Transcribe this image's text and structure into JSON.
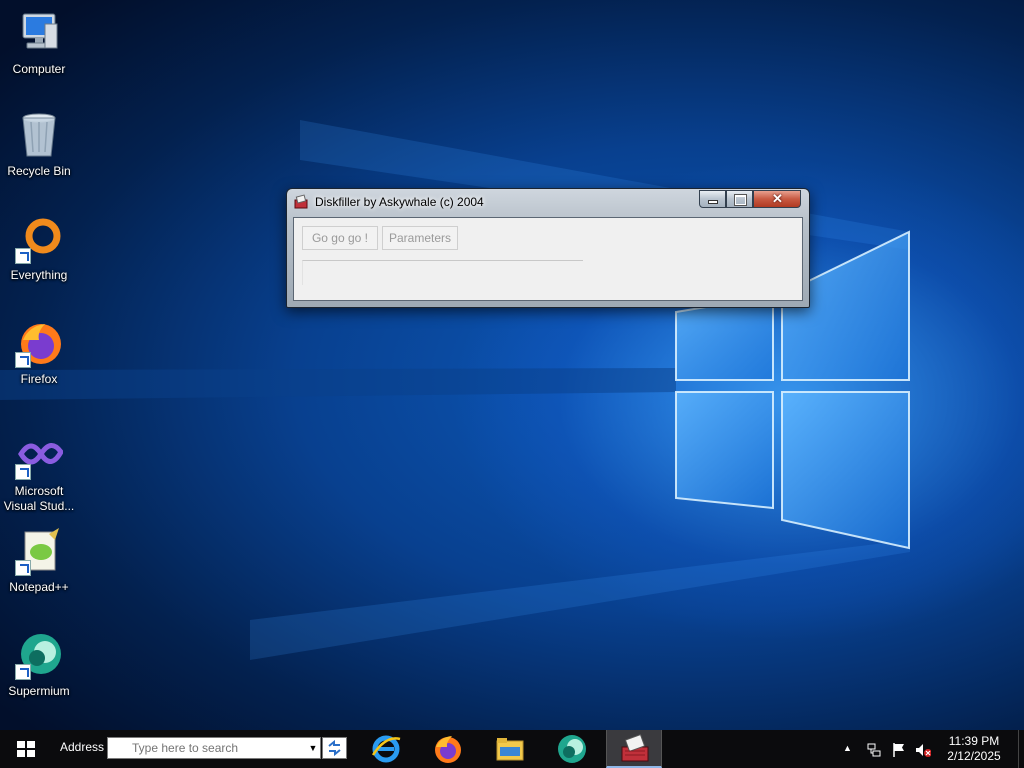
{
  "desktop": {
    "icons": [
      {
        "label": "Computer",
        "icon": "computer-icon"
      },
      {
        "label": "Recycle Bin",
        "icon": "recycle-bin-icon"
      },
      {
        "label": "Everything",
        "icon": "everything-icon"
      },
      {
        "label": "Firefox",
        "icon": "firefox-icon"
      },
      {
        "label": "Microsoft Visual Stud...",
        "icon": "visual-studio-icon"
      },
      {
        "label": "Notepad++",
        "icon": "notepadpp-icon"
      },
      {
        "label": "Supermium",
        "icon": "supermium-icon"
      }
    ]
  },
  "window": {
    "title": "Diskfiller by Askywhale (c) 2004",
    "icon": "diskfiller-app-icon",
    "buttons": {
      "go": "Go go go !",
      "parameters": "Parameters"
    },
    "controls": [
      "minimize-icon",
      "maximize-icon",
      "close-icon"
    ]
  },
  "taskbar": {
    "address_label": "Address",
    "search_placeholder": "Type here to search",
    "pinned": [
      "internet-explorer-icon",
      "firefox-icon",
      "file-explorer-icon",
      "supermium-icon",
      "diskfiller-icon"
    ],
    "clock": {
      "time": "11:39 PM",
      "date": "2/12/2025"
    }
  },
  "colors": {
    "taskbar": "#0b0b0d",
    "wallpaper_accent": "#0d5cc0",
    "close_button": "#c85a42"
  }
}
